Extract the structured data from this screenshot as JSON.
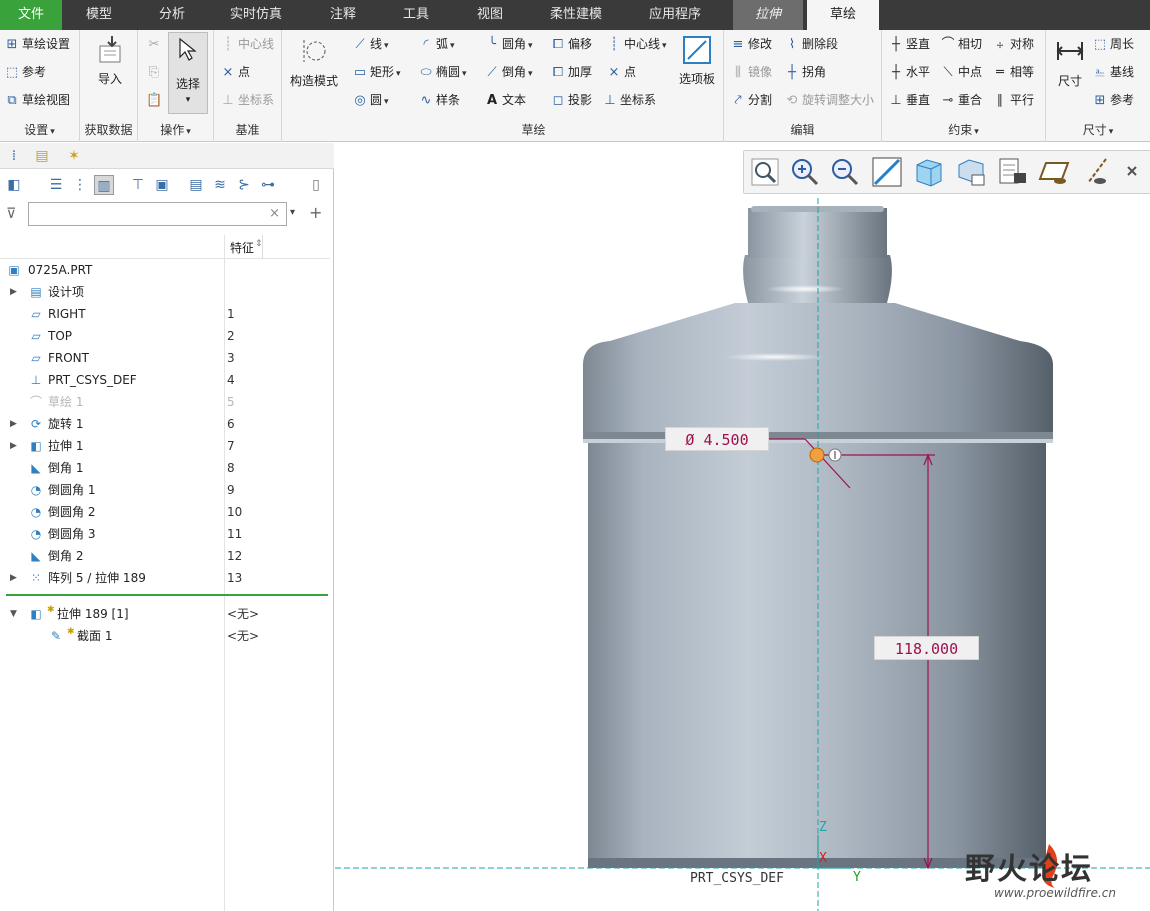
{
  "menu": {
    "tabs": [
      "文件",
      "模型",
      "分析",
      "实时仿真",
      "注释",
      "工具",
      "视图",
      "柔性建模",
      "应用程序",
      "拉伸",
      "草绘"
    ]
  },
  "ribbon": {
    "setup": {
      "label": "设置",
      "items": [
        "草绘设置",
        "参考",
        "草绘视图"
      ]
    },
    "getdata": {
      "label": "获取数据",
      "import": "导入"
    },
    "operations": {
      "label": "操作",
      "select": "选择"
    },
    "datum": {
      "label": "基准",
      "items": [
        "中心线",
        "点",
        "坐标系"
      ]
    },
    "construct": {
      "label": "构造模式"
    },
    "sketch": {
      "label": "草绘",
      "items": [
        "线",
        "弧",
        "圆角",
        "偏移",
        "中心线",
        "矩形",
        "椭圆",
        "倒角",
        "加厚",
        "点",
        "圆",
        "样条",
        "文本",
        "投影",
        "坐标系"
      ],
      "palette": "选项板"
    },
    "edit": {
      "label": "编辑",
      "items": [
        "修改",
        "删除段",
        "镜像",
        "拐角",
        "分割",
        "旋转调整大小"
      ]
    },
    "constraints": {
      "label": "约束",
      "items": [
        "竖直",
        "相切",
        "对称",
        "水平",
        "中点",
        "相等",
        "垂直",
        "重合",
        "平行"
      ]
    },
    "dimension": {
      "label": "尺寸",
      "dim": "尺寸",
      "items": [
        "周长",
        "基线",
        "参考"
      ]
    }
  },
  "tree": {
    "col_header": "特征",
    "items": [
      {
        "name": "0725A.PRT",
        "num": "",
        "icon": "part-icon"
      },
      {
        "name": "设计项",
        "num": "",
        "icon": "design-items-icon"
      },
      {
        "name": "RIGHT",
        "num": "1",
        "icon": "datum-plane-icon"
      },
      {
        "name": "TOP",
        "num": "2",
        "icon": "datum-plane-icon"
      },
      {
        "name": "FRONT",
        "num": "3",
        "icon": "datum-plane-icon"
      },
      {
        "name": "PRT_CSYS_DEF",
        "num": "4",
        "icon": "csys-icon"
      },
      {
        "name": "草绘 1",
        "num": "5",
        "icon": "sketch-icon"
      },
      {
        "name": "旋转 1",
        "num": "6",
        "icon": "revolve-icon"
      },
      {
        "name": "拉伸 1",
        "num": "7",
        "icon": "extrude-icon"
      },
      {
        "name": "倒角 1",
        "num": "8",
        "icon": "chamfer-icon"
      },
      {
        "name": "倒圆角 1",
        "num": "9",
        "icon": "round-icon"
      },
      {
        "name": "倒圆角 2",
        "num": "10",
        "icon": "round-icon"
      },
      {
        "name": "倒圆角 3",
        "num": "11",
        "icon": "round-icon"
      },
      {
        "name": "倒角 2",
        "num": "12",
        "icon": "chamfer-icon"
      },
      {
        "name": "阵列 5 / 拉伸 189",
        "num": "13",
        "icon": "pattern-icon"
      },
      {
        "name": "拉伸 189 [1]",
        "num": "<无>",
        "icon": "extrude-icon"
      },
      {
        "name": "截面 1",
        "num": "<无>",
        "icon": "section-icon"
      }
    ]
  },
  "graphics": {
    "dim_diameter": "Ø 4.500",
    "dim_height": "118.000",
    "csys_label": "PRT_CSYS_DEF",
    "axis_z": "Z",
    "axis_x": "X",
    "axis_y": "Y",
    "colors": {
      "body": "#9aa7b4",
      "dimension": "#a01050",
      "datum": "#1aa6a6",
      "accent": "#3aa23a"
    }
  },
  "watermark": {
    "title": "野火论坛",
    "url": "www.proewildfire.cn"
  }
}
